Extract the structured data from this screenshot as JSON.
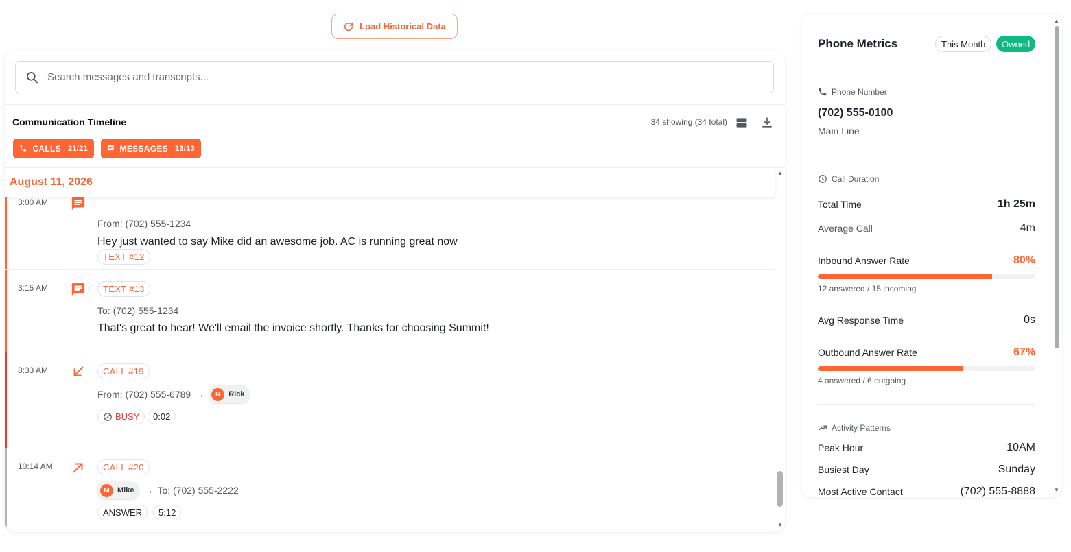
{
  "toolbar": {
    "load_label": "Load Historical Data"
  },
  "search": {
    "placeholder": "Search messages and transcripts..."
  },
  "timeline": {
    "title": "Communication Timeline",
    "count": "34 showing (34 total)",
    "filters": {
      "calls_label": "CALLS",
      "calls_count": "21/21",
      "messages_label": "MESSAGES",
      "messages_count": "13/13"
    },
    "date": "August 11, 2026",
    "entries": [
      {
        "time": "3:00 AM",
        "tag": "TEXT #12",
        "from": "From: (702) 555-1234",
        "body": "Hey just wanted to say Mike did an awesome job. AC is running great now"
      },
      {
        "time": "3:15 AM",
        "tag": "TEXT #13",
        "from": "To: (702) 555-1234",
        "body": "That's great to hear! We'll email the invoice shortly. Thanks for choosing Summit!"
      },
      {
        "time": "8:33 AM",
        "tag": "CALL #19",
        "from": "From: (702) 555-6789",
        "arrow": "→",
        "person_initial": "R",
        "person_name": "Rick",
        "status": "BUSY",
        "duration": "0:02"
      },
      {
        "time": "10:14 AM",
        "tag": "CALL #20",
        "person_initial": "M",
        "person_name": "Mike",
        "arrow": "→",
        "to": "To: (702) 555-2222",
        "status": "ANSWER",
        "duration": "5:12"
      }
    ]
  },
  "metrics": {
    "title": "Phone Metrics",
    "period": "This Month",
    "ownership": "Owned",
    "phone_section": "Phone Number",
    "phone_number": "(702) 555-0100",
    "phone_label": "Main Line",
    "duration_section": "Call Duration",
    "total_time_label": "Total Time",
    "total_time": "1h 25m",
    "avg_call_label": "Average Call",
    "avg_call": "4m",
    "inbound_label": "Inbound Answer Rate",
    "inbound_value": "80%",
    "inbound_fraction": 0.8,
    "inbound_sub": "12 answered / 15 incoming",
    "avg_response_label": "Avg Response Time",
    "avg_response": "0s",
    "outbound_label": "Outbound Answer Rate",
    "outbound_value": "67%",
    "outbound_fraction": 0.67,
    "outbound_sub": "4 answered / 6 outgoing",
    "activity_section": "Activity Patterns",
    "peak_hour_label": "Peak Hour",
    "peak_hour": "10AM",
    "busiest_day_label": "Busiest Day",
    "busiest_day": "Sunday",
    "most_active_label": "Most Active Contact",
    "most_active": "(702) 555-8888"
  },
  "colors": {
    "accent": "#ff6633",
    "accent_text": "#ef6a3c",
    "owned": "#10b981",
    "busy": "#e53935"
  }
}
